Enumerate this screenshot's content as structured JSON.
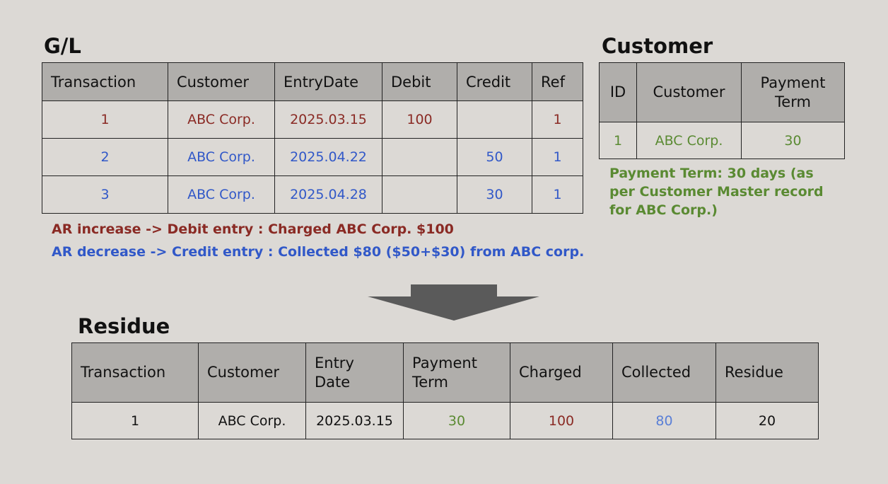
{
  "gl": {
    "title": "G/L",
    "headers": [
      "Transaction",
      "Customer",
      "EntryDate",
      "Debit",
      "Credit",
      "Ref"
    ],
    "rows": [
      {
        "transaction": "1",
        "customer": "ABC Corp.",
        "entry_date": "2025.03.15",
        "debit": "100",
        "credit": "",
        "ref": "1",
        "color": "#8a2a24"
      },
      {
        "transaction": "2",
        "customer": "ABC Corp.",
        "entry_date": "2025.04.22",
        "debit": "",
        "credit": "50",
        "ref": "1",
        "color": "#3158c8"
      },
      {
        "transaction": "3",
        "customer": "ABC Corp.",
        "entry_date": "2025.04.28",
        "debit": "",
        "credit": "30",
        "ref": "1",
        "color": "#3158c8"
      }
    ]
  },
  "notes": {
    "ar_increase": "AR increase -> Debit entry : Charged ABC Corp.  $100",
    "ar_decrease": "AR decrease -> Credit entry : Collected $80 ($50+$30) from ABC corp."
  },
  "customer": {
    "title": "Customer",
    "headers": [
      "ID",
      "Customer",
      "Payment Term"
    ],
    "rows": [
      {
        "id": "1",
        "customer": "ABC Corp.",
        "payment_term": "30"
      }
    ],
    "note": "Payment Term: 30 days (as per Customer Master record for ABC Corp.)"
  },
  "residue": {
    "title": "Residue",
    "headers": [
      "Transaction",
      "Customer",
      "Entry Date",
      "Payment Term",
      "Charged",
      "Collected",
      "Residue"
    ],
    "rows": [
      {
        "transaction": "1",
        "customer": "ABC Corp.",
        "entry_date": "2025.03.15",
        "payment_term": "30",
        "charged": "100",
        "collected": "80",
        "residue": "20"
      }
    ]
  },
  "colors": {
    "debit": "#8a2a24",
    "credit": "#3158c8",
    "payment_term": "#5a8a32",
    "collected": "#5a7fd6",
    "header_bg": "#b0aeab",
    "background": "#dcd9d5",
    "arrow": "#5a5a5a"
  },
  "icons": {
    "flow_arrow": "down-arrow-icon"
  }
}
